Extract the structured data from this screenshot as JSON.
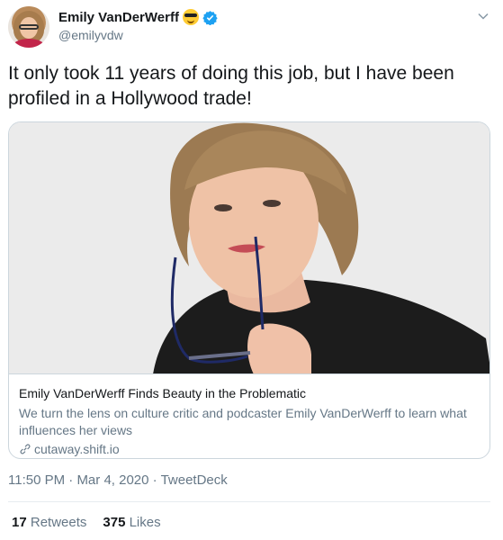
{
  "user": {
    "display_name": "Emily VanDerWerff",
    "handle": "@emilyvdw",
    "emoji_icon": "sunglasses-emoji-icon",
    "verified_icon": "verified-badge-icon"
  },
  "tweet": {
    "text": "It only took 11 years of doing this job, but I have been profiled in a Hollywood trade!"
  },
  "card": {
    "title": "Emily VanDerWerff Finds Beauty in the Problematic",
    "description": "We turn the lens on culture critic and podcaster Emily VanDerWerff to learn what influences her views",
    "domain": "cutaway.shift.io"
  },
  "meta": {
    "time": "11:50 PM",
    "separator": "·",
    "date": "Mar 4, 2020",
    "source": "TweetDeck"
  },
  "stats": {
    "retweets_count": "17",
    "retweets_label": "Retweets",
    "likes_count": "375",
    "likes_label": "Likes"
  },
  "colors": {
    "text": "#14171a",
    "secondary": "#657786",
    "border": "#ccd6dd",
    "verified": "#1da1f2"
  }
}
